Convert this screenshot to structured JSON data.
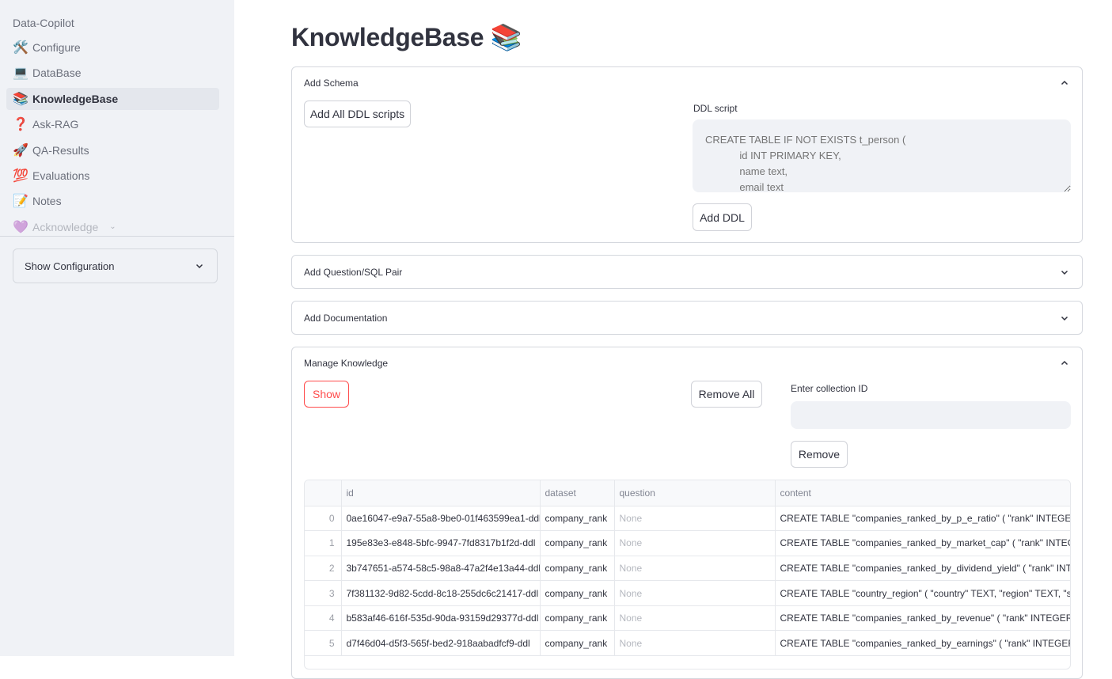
{
  "sidebar": {
    "app_name": "Data-Copilot",
    "items": [
      {
        "icon": "🛠️",
        "icon_name": "hammer-wrench-icon",
        "label": "Configure"
      },
      {
        "icon": "💻",
        "icon_name": "laptop-icon",
        "label": "DataBase"
      },
      {
        "icon": "📚",
        "icon_name": "books-icon",
        "label": "KnowledgeBase",
        "active": true
      },
      {
        "icon": "❓",
        "icon_name": "question-mark-icon",
        "label": "Ask-RAG"
      },
      {
        "icon": "🚀",
        "icon_name": "rocket-icon",
        "label": "QA-Results"
      },
      {
        "icon": "💯",
        "icon_name": "hundred-points-icon",
        "label": "Evaluations"
      },
      {
        "icon": "📝",
        "icon_name": "memo-icon",
        "label": "Notes"
      },
      {
        "icon": "💜",
        "icon_name": "purple-heart-icon",
        "label": "Acknowledge"
      }
    ],
    "show_more_icon": "⌄",
    "config_expander_label": "Show Configuration"
  },
  "main": {
    "title": "KnowledgeBase 📚",
    "add_schema": {
      "header": "Add Schema",
      "add_all_button": "Add All DDL scripts",
      "ddl_label": "DDL script",
      "ddl_placeholder": "CREATE TABLE IF NOT EXISTS t_person (\n            id INT PRIMARY KEY,\n            name text,\n            email text",
      "add_ddl_button": "Add DDL"
    },
    "add_qa": {
      "header": "Add Question/SQL Pair"
    },
    "add_doc": {
      "header": "Add Documentation"
    },
    "manage": {
      "header": "Manage Knowledge",
      "show_button": "Show",
      "remove_all_button": "Remove All",
      "collection_label": "Enter collection ID",
      "collection_value": "",
      "remove_button": "Remove",
      "table": {
        "columns": [
          "",
          "id",
          "dataset",
          "question",
          "content"
        ],
        "rows": [
          {
            "index": "0",
            "id": "0ae16047-e9a7-55a8-9be0-01f463599ea1-ddl",
            "dataset": "company_rank",
            "question": "None",
            "content": "CREATE TABLE \"companies_ranked_by_p_e_ratio\" ( \"rank\" INTEGER,  \"name\" TEXT"
          },
          {
            "index": "1",
            "id": "195e83e3-e848-5bfc-9947-7fd8317b1f2d-ddl",
            "dataset": "company_rank",
            "question": "None",
            "content": "CREATE TABLE \"companies_ranked_by_market_cap\" ( \"rank\" INTEGER,  \"name\" TEXT"
          },
          {
            "index": "2",
            "id": "3b747651-a574-58c5-98a8-47a2f4e13a44-ddl",
            "dataset": "company_rank",
            "question": "None",
            "content": "CREATE TABLE \"companies_ranked_by_dividend_yield\" ( \"rank\" INTEGER,  \"name\" TEXT"
          },
          {
            "index": "3",
            "id": "7f381132-9d82-5cdd-8c18-255dc6c21417-ddl",
            "dataset": "company_rank",
            "question": "None",
            "content": "CREATE TABLE \"country_region\" ( \"country\" TEXT,  \"region\" TEXT,  \"sub_region\" TEXT"
          },
          {
            "index": "4",
            "id": "b583af46-616f-535d-90da-93159d29377d-ddl",
            "dataset": "company_rank",
            "question": "None",
            "content": "CREATE TABLE \"companies_ranked_by_revenue\" ( \"rank\" INTEGER,  \"name\" TEXT"
          },
          {
            "index": "5",
            "id": "d7f46d04-d5f3-565f-bed2-918aabadfcf9-ddl",
            "dataset": "company_rank",
            "question": "None",
            "content": "CREATE TABLE \"companies_ranked_by_earnings\" ( \"rank\" INTEGER,  \"name\" TEXT"
          }
        ]
      }
    }
  }
}
